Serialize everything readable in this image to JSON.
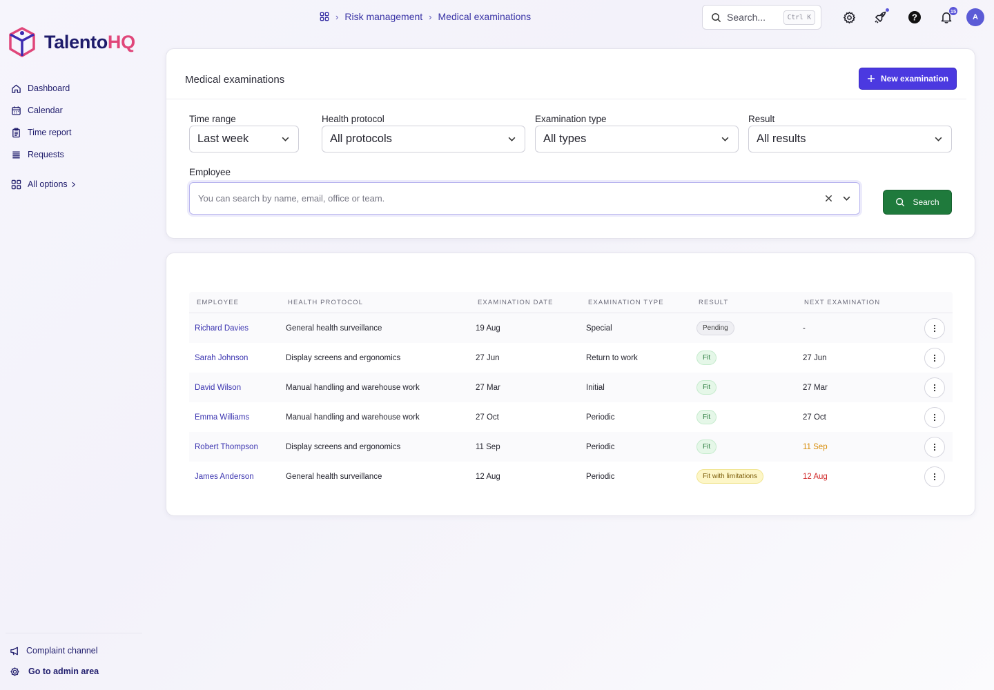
{
  "brand": {
    "name_main": "Talento",
    "name_accent": "HQ",
    "accent_color": "#e0467a",
    "primary_color": "#1e1b6b"
  },
  "sidebar": {
    "items": [
      {
        "label": "Dashboard",
        "icon": "home-icon"
      },
      {
        "label": "Calendar",
        "icon": "calendar-icon"
      },
      {
        "label": "Time report",
        "icon": "clipboard-icon"
      },
      {
        "label": "Requests",
        "icon": "list-icon"
      }
    ],
    "all_options": "All options",
    "bottom": [
      {
        "label": "Complaint channel",
        "icon": "megaphone-icon"
      },
      {
        "label": "Go to admin area",
        "icon": "gear-icon"
      }
    ]
  },
  "breadcrumb": {
    "section": "Risk management",
    "page": "Medical examinations"
  },
  "topbar": {
    "search_placeholder": "Search...",
    "shortcut": "Ctrl K",
    "notifications_count": "15",
    "avatar_initial": "A"
  },
  "filters": {
    "title": "Medical examinations",
    "new_button": "New examination",
    "time_range": {
      "label": "Time range",
      "value": "Last week"
    },
    "health_protocol": {
      "label": "Health protocol",
      "value": "All protocols"
    },
    "examination_type": {
      "label": "Examination type",
      "value": "All types"
    },
    "result": {
      "label": "Result",
      "value": "All results"
    },
    "employee": {
      "label": "Employee",
      "placeholder": "You can search by name, email, office or team."
    },
    "search_button": "Search"
  },
  "table": {
    "columns": [
      "EMPLOYEE",
      "HEALTH PROTOCOL",
      "EXAMINATION DATE",
      "EXAMINATION TYPE",
      "RESULT",
      "NEXT EXAMINATION"
    ],
    "rows": [
      {
        "employee": "Richard Davies",
        "protocol": "General health surveillance",
        "date": "19 Aug",
        "type": "Special",
        "result": "Pending",
        "result_status": "pending",
        "next": "-",
        "next_status": "normal"
      },
      {
        "employee": "Sarah Johnson",
        "protocol": "Display screens and ergonomics",
        "date": "27 Jun",
        "type": "Return to work",
        "result": "Fit",
        "result_status": "fit",
        "next": "27 Jun",
        "next_status": "normal"
      },
      {
        "employee": "David Wilson",
        "protocol": "Manual handling and warehouse work",
        "date": "27 Mar",
        "type": "Initial",
        "result": "Fit",
        "result_status": "fit",
        "next": "27 Mar",
        "next_status": "normal"
      },
      {
        "employee": "Emma Williams",
        "protocol": "Manual handling and warehouse work",
        "date": "27 Oct",
        "type": "Periodic",
        "result": "Fit",
        "result_status": "fit",
        "next": "27 Oct",
        "next_status": "normal"
      },
      {
        "employee": "Robert Thompson",
        "protocol": "Display screens and ergonomics",
        "date": "11 Sep",
        "type": "Periodic",
        "result": "Fit",
        "result_status": "fit",
        "next": "11 Sep",
        "next_status": "warn"
      },
      {
        "employee": "James Anderson",
        "protocol": "General health surveillance",
        "date": "12 Aug",
        "type": "Periodic",
        "result": "Fit with limitations",
        "result_status": "limit",
        "next": "12 Aug",
        "next_status": "alert"
      }
    ]
  }
}
